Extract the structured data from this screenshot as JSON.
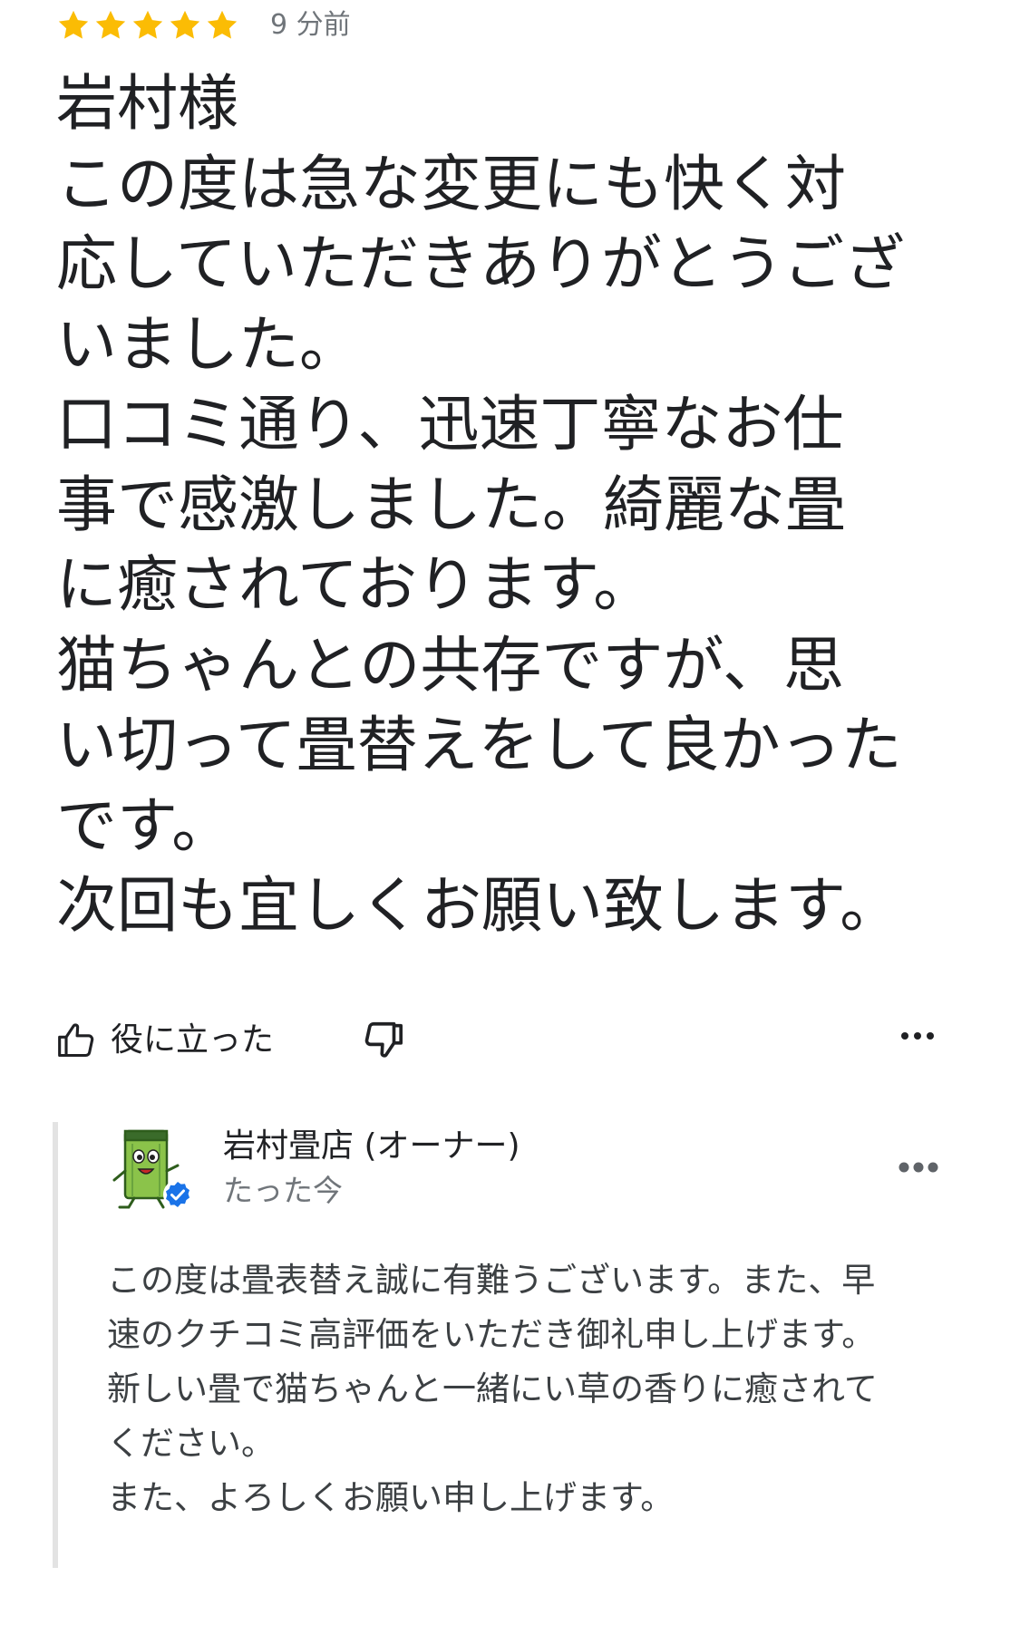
{
  "review": {
    "rating": 5,
    "max_rating": 5,
    "time": "9 分前",
    "text_lines": [
      "岩村様",
      "この度は急な変更にも快く対",
      "応していただきありがとうござ",
      "いました。",
      "口コミ通り、迅速丁寧なお仕",
      "事で感激しました。綺麗な畳",
      "に癒されております。",
      "猫ちゃんとの共存ですが、思",
      "い切って畳替えをして良かった",
      "です。",
      "次回も宜しくお願い致します。"
    ],
    "star_color": "#fbbc04"
  },
  "actions": {
    "helpful_label": "役に立った",
    "helpful_icon": "thumbs-up-icon",
    "not_helpful_icon": "thumbs-down-icon",
    "more_icon": "more-horizontal-icon"
  },
  "owner_reply": {
    "name": "岩村畳店 (オーナー)",
    "time": "たった今",
    "avatar_icon": "tatami-mascot-icon",
    "verified_icon": "verified-badge-icon",
    "verified_color": "#1a73e8",
    "more_icon": "more-horizontal-icon",
    "text_lines": [
      "この度は畳表替え誠に有難うございます。また、早",
      "速のクチコミ高評価をいただき御礼申し上げます。",
      "新しい畳で猫ちゃんと一緒にい草の香りに癒されて",
      "ください。",
      "また、よろしくお願い申し上げます。"
    ]
  }
}
